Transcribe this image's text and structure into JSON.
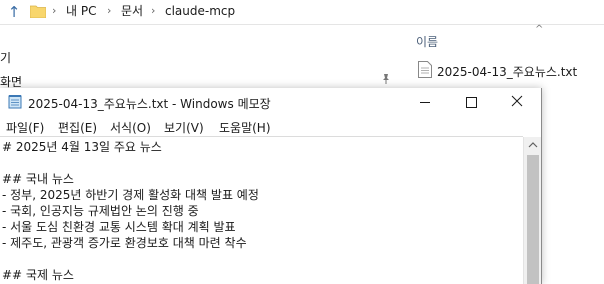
{
  "explorer": {
    "breadcrumb": [
      "내 PC",
      "문서",
      "claude-mcp"
    ],
    "left_fragments": [
      "기",
      "화면"
    ],
    "column_header": "이름",
    "file_name": "2025-04-13_주요뉴스.txt"
  },
  "notepad": {
    "title": "2025-04-13_주요뉴스.txt - Windows 메모장",
    "menu": [
      "파일(F)",
      "편집(E)",
      "서식(O)",
      "보기(V)",
      "도움말(H)"
    ],
    "lines": [
      "# 2025년 4월 13일 주요 뉴스",
      "",
      "## 국내 뉴스",
      "- 정부, 2025년 하반기 경제 활성화 대책 발표 예정",
      "- 국회, 인공지능 규제법안 논의 진행 중",
      "- 서울 도심 친환경 교통 시스템 확대 계획 발표",
      "- 제주도, 관광객 증가로 환경보호 대책 마련 착수",
      "",
      "## 국제 뉴스"
    ]
  }
}
